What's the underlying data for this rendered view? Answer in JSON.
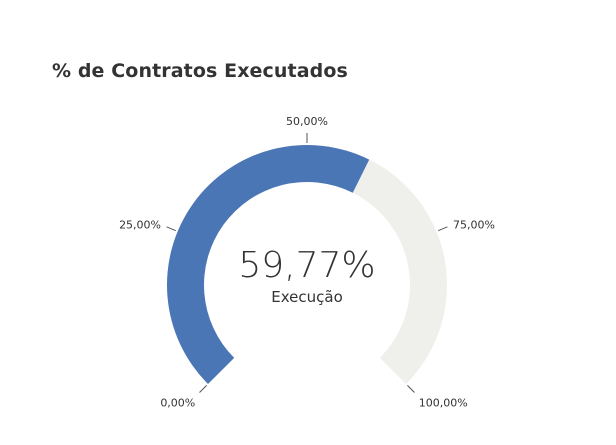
{
  "chart_data": {
    "type": "gauge",
    "title": "% de Contratos Executados",
    "value": 59.77,
    "value_label": "59,77%",
    "caption": "Execução",
    "min": 0,
    "max": 100,
    "ticks": [
      {
        "value": 0,
        "label": "0,00%"
      },
      {
        "value": 25,
        "label": "25,00%"
      },
      {
        "value": 50,
        "label": "50,00%"
      },
      {
        "value": 75,
        "label": "75,00%"
      },
      {
        "value": 100,
        "label": "100,00%"
      }
    ],
    "colors": {
      "filled": "#4a76b6",
      "track": "#efefec",
      "tick_line": "#555555"
    }
  }
}
